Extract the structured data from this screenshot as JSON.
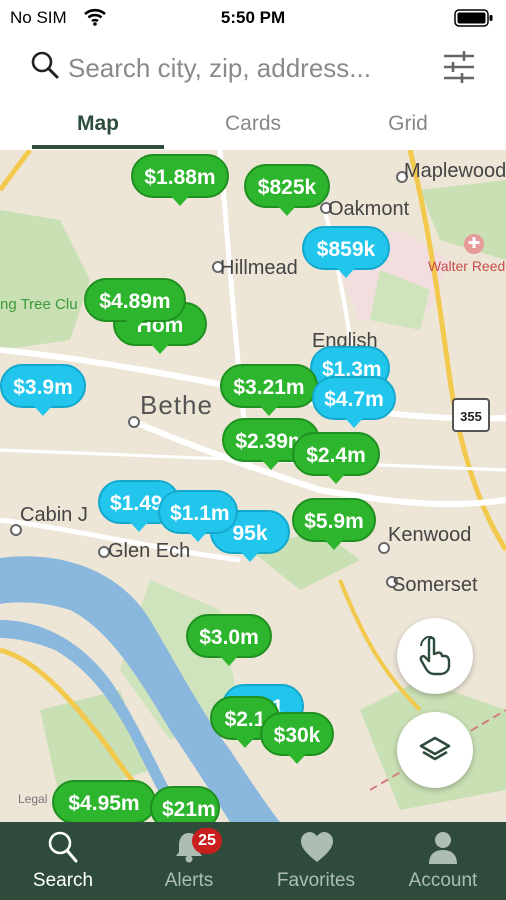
{
  "status_bar": {
    "carrier": "No SIM",
    "time": "5:50 PM"
  },
  "search": {
    "placeholder": "Search city, zip, address..."
  },
  "tabs": [
    {
      "label": "Map",
      "active": true
    },
    {
      "label": "Cards",
      "active": false
    },
    {
      "label": "Grid",
      "active": false
    }
  ],
  "map": {
    "places": {
      "maplewood": "Maplewood",
      "oakmont": "Oakmont",
      "hillmead": "Hillmead",
      "bethesda": "Bethe",
      "english": "English",
      "cabin_john": "Cabin J",
      "glen_echo": "Glen Ech",
      "kenwood": "Kenwood",
      "somerset": "Somerset",
      "tree_club": "ng Tree Clu",
      "walter_reed": "Walter Reed National Military Medical Cen"
    },
    "route_shield": "355",
    "legal": "Legal",
    "pins": [
      {
        "price": "$1.88m",
        "color": "green"
      },
      {
        "price": "$825k",
        "color": "green"
      },
      {
        "price": "$859k",
        "color": "blue"
      },
      {
        "price": "$4.89m",
        "color": "green"
      },
      {
        "price": "Hom",
        "color": "green"
      },
      {
        "price": "$3.9m",
        "color": "blue"
      },
      {
        "price": "$1.3m",
        "color": "blue"
      },
      {
        "price": "$3.21m",
        "color": "green"
      },
      {
        "price": "$4.7m",
        "color": "blue"
      },
      {
        "price": "$2.39m",
        "color": "green"
      },
      {
        "price": "$2.4m",
        "color": "green"
      },
      {
        "price": "$1.49m",
        "color": "blue"
      },
      {
        "price": "$1.1m",
        "color": "blue"
      },
      {
        "price": "95k",
        "color": "blue"
      },
      {
        "price": "$5.9m",
        "color": "green"
      },
      {
        "price": "$3.0m",
        "color": "green"
      },
      {
        "price": "$2.1",
        "color": "green"
      },
      {
        "price": "$30k",
        "color": "green"
      },
      {
        "price": "$4.95m",
        "color": "green"
      },
      {
        "price": "$21m",
        "color": "green"
      }
    ]
  },
  "tabbar": {
    "items": [
      {
        "label": "Search",
        "icon": "search-icon",
        "active": true
      },
      {
        "label": "Alerts",
        "icon": "bell-icon",
        "badge": "25"
      },
      {
        "label": "Favorites",
        "icon": "heart-icon"
      },
      {
        "label": "Account",
        "icon": "person-icon"
      }
    ]
  },
  "colors": {
    "brand_green": "#2e4b3b",
    "pin_green": "#2db52d",
    "pin_blue": "#22c6ec",
    "badge_red": "#c81e1e"
  }
}
